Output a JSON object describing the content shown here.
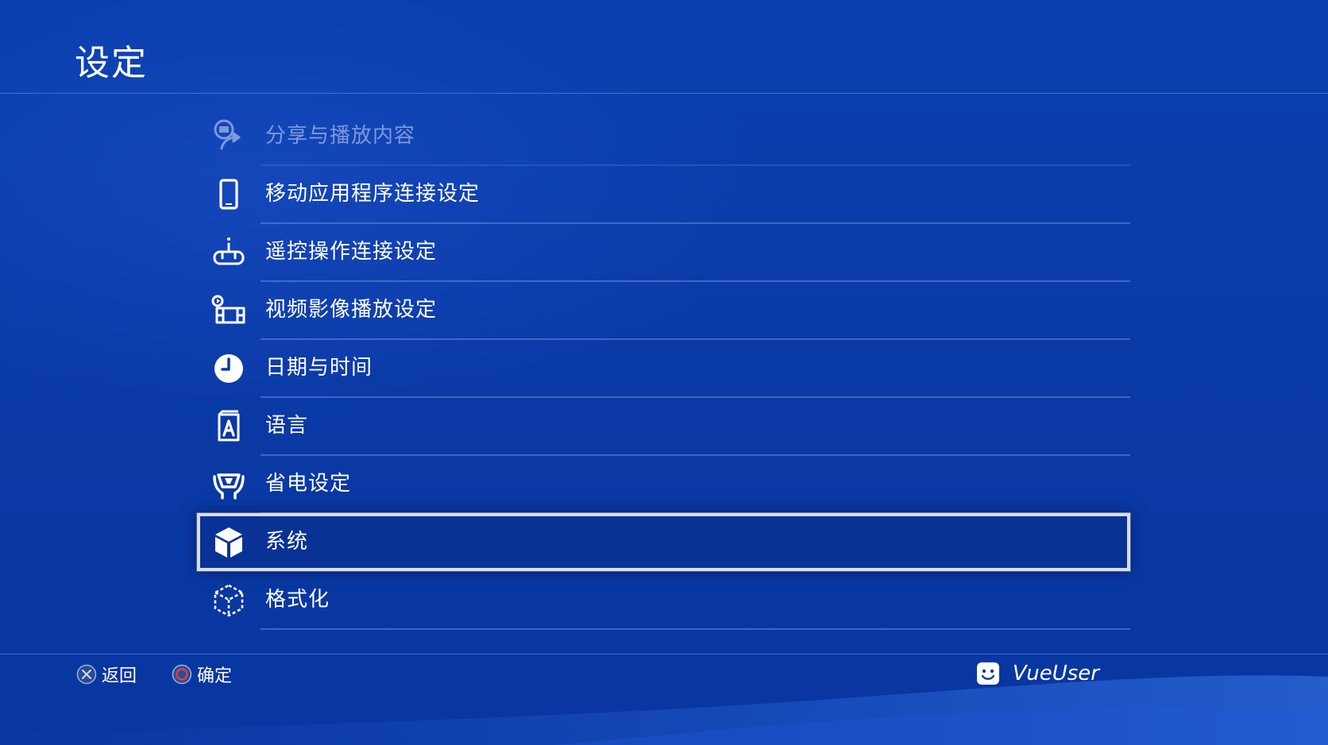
{
  "header": {
    "title": "设定"
  },
  "menu": {
    "items": [
      {
        "label": "分享与播放内容",
        "icon": "share-play-icon",
        "state": "faded"
      },
      {
        "label": "移动应用程序连接设定",
        "icon": "smartphone-icon",
        "state": "normal"
      },
      {
        "label": "遥控操作连接设定",
        "icon": "remote-play-icon",
        "state": "normal"
      },
      {
        "label": "视频影像播放设定",
        "icon": "video-playback-icon",
        "state": "normal"
      },
      {
        "label": "日期与时间",
        "icon": "clock-icon",
        "state": "normal"
      },
      {
        "label": "语言",
        "icon": "language-icon",
        "state": "normal"
      },
      {
        "label": "省电设定",
        "icon": "power-save-icon",
        "state": "normal"
      },
      {
        "label": "系统",
        "icon": "system-cube-icon",
        "state": "selected"
      },
      {
        "label": "格式化",
        "icon": "initialize-cube-icon",
        "state": "normal"
      }
    ]
  },
  "footer": {
    "back_label": "返回",
    "confirm_label": "确定",
    "back_icon": "cross-button-icon",
    "confirm_icon": "circle-button-icon"
  },
  "user": {
    "name": "VueUser",
    "avatar_icon": "smiley-avatar-icon"
  },
  "colors": {
    "background": "#0a3aa6",
    "selection_border": "#d8dde8",
    "circle_button": "#e0403a"
  }
}
